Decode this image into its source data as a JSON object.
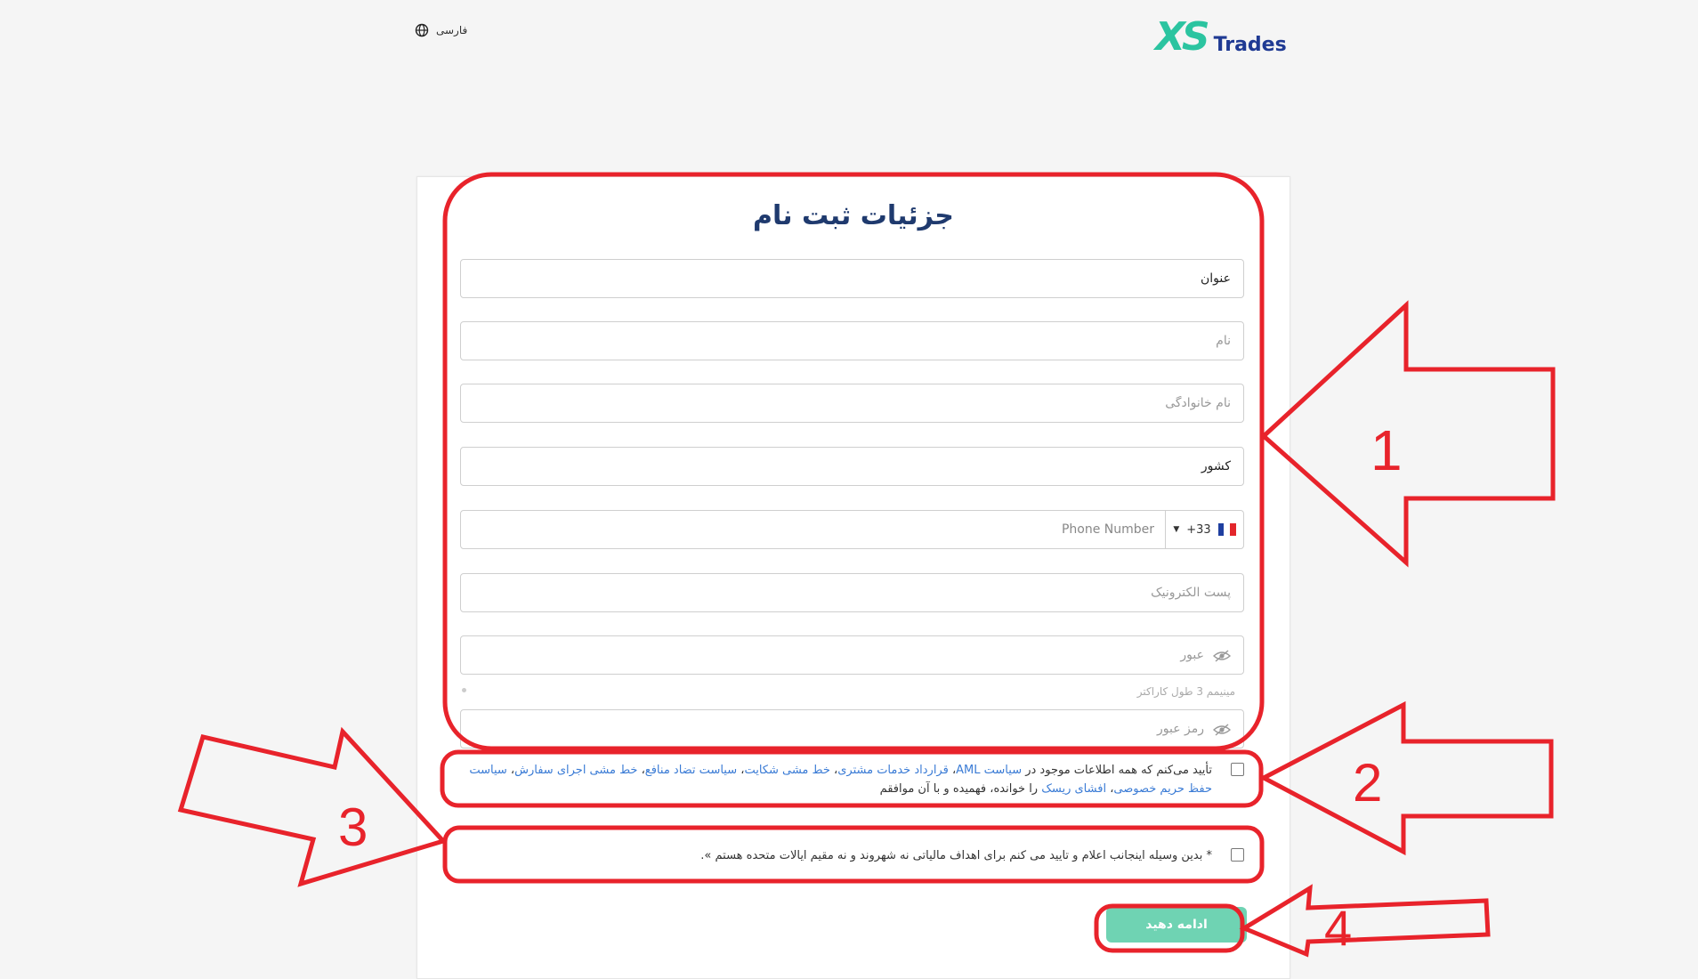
{
  "header": {
    "language_label": "فارسی",
    "logo_xs": "XS",
    "logo_trades": "Trades"
  },
  "form": {
    "title": "جزئیات ثبت نام",
    "title_field": {
      "placeholder": "عنوان",
      "value": ""
    },
    "first_name": {
      "placeholder": "نام",
      "value": ""
    },
    "last_name": {
      "placeholder": "نام خانوادگی",
      "value": ""
    },
    "country": {
      "placeholder": "کشور",
      "value": ""
    },
    "phone": {
      "code": "+33",
      "placeholder": "Phone Number",
      "value": ""
    },
    "email": {
      "placeholder": "پست الکترونیک",
      "value": ""
    },
    "password": {
      "placeholder": "عبور",
      "value": ""
    },
    "password_hint": "مینیمم 3 طول کاراکتر",
    "confirm_password": {
      "placeholder": "رمز عبور",
      "value": ""
    },
    "terms": {
      "prefix": "تأیید می‌کنم که همه اطلاعات موجود در",
      "links": [
        "سیاست AML",
        "قرارداد خدمات مشتری",
        "خط مشی شکایت",
        "سیاست تضاد منافع",
        "خط مشی اجرای سفارش",
        "سیاست حفظ حریم خصوصی",
        "افشای ریسک"
      ],
      "suffix": "را خوانده، فهمیده و با آن موافقم"
    },
    "us_declaration": "* بدین وسیله اینجانب اعلام و تایید می کنم برای اهداف مالیاتی نه شهروند و نه مقیم ایالات متحده هستم ‌».",
    "continue_label": "ادامه دهید"
  },
  "annotations": {
    "labels": [
      "1",
      "2",
      "3",
      "4"
    ],
    "color": "#e8232b"
  },
  "colors": {
    "accent": "#2bc4a0",
    "brand": "#1f3a93",
    "button": "#6fd3b3",
    "link": "#3a7bd5"
  }
}
